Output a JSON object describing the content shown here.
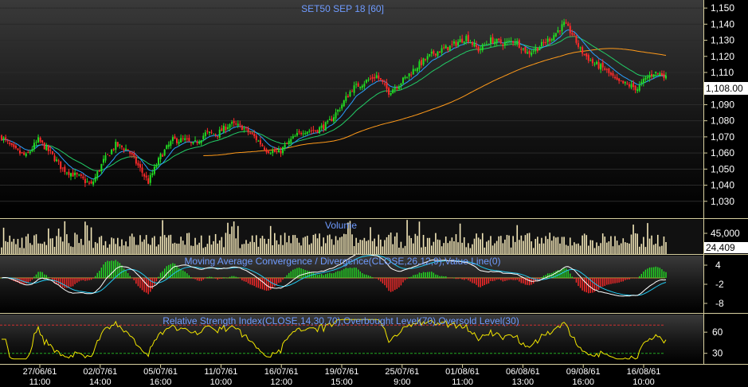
{
  "colors": {
    "bg_top": "#3a3a3a",
    "bg_bottom": "#000000",
    "up_candle": "#22dd22",
    "down_candle": "#ff2a2a",
    "ma_short": "#2aa0ff",
    "ma_mid": "#22cc66",
    "ma_long": "#ff9a1a",
    "volume": "#f2e6b8",
    "macd_line": "#ffffff",
    "signal_line": "#22c8f0",
    "rsi_line": "#f2e600",
    "ob_level": "#d03030",
    "os_level": "#22aa22",
    "title_text": "#6f9bff",
    "panel_border": "#d8d0a0",
    "last_price_box": "#ffffff"
  },
  "chart_data": [
    {
      "type": "candlestick",
      "title": "SET50 SEP 18   [60]",
      "ylim": [
        1020,
        1155
      ],
      "yticks": [
        "1,150",
        "1,140",
        "1,130",
        "1,120",
        "1,110",
        "1,100",
        "1,090",
        "1,080",
        "1,070",
        "1,060",
        "1,050",
        "1,040",
        "1,030"
      ],
      "last_price_label": "1,108.00",
      "last_price": 1108,
      "path_keypoints": [
        [
          0,
          1070
        ],
        [
          6,
          1062
        ],
        [
          12,
          1058
        ],
        [
          18,
          1068
        ],
        [
          24,
          1060
        ],
        [
          30,
          1050
        ],
        [
          38,
          1045
        ],
        [
          44,
          1040
        ],
        [
          50,
          1055
        ],
        [
          56,
          1065
        ],
        [
          62,
          1062
        ],
        [
          68,
          1050
        ],
        [
          72,
          1042
        ],
        [
          78,
          1058
        ],
        [
          84,
          1068
        ],
        [
          90,
          1068
        ],
        [
          94,
          1065
        ],
        [
          100,
          1072
        ],
        [
          106,
          1072
        ],
        [
          112,
          1078
        ],
        [
          118,
          1076
        ],
        [
          124,
          1070
        ],
        [
          130,
          1062
        ],
        [
          136,
          1060
        ],
        [
          142,
          1068
        ],
        [
          148,
          1074
        ],
        [
          154,
          1074
        ],
        [
          160,
          1078
        ],
        [
          166,
          1088
        ],
        [
          172,
          1100
        ],
        [
          178,
          1104
        ],
        [
          184,
          1108
        ],
        [
          190,
          1098
        ],
        [
          196,
          1104
        ],
        [
          204,
          1114
        ],
        [
          212,
          1122
        ],
        [
          220,
          1126
        ],
        [
          228,
          1132
        ],
        [
          234,
          1124
        ],
        [
          240,
          1130
        ],
        [
          246,
          1128
        ],
        [
          252,
          1130
        ],
        [
          258,
          1122
        ],
        [
          264,
          1126
        ],
        [
          270,
          1132
        ],
        [
          276,
          1140
        ],
        [
          280,
          1134
        ],
        [
          284,
          1124
        ],
        [
          290,
          1116
        ],
        [
          296,
          1112
        ],
        [
          302,
          1104
        ],
        [
          308,
          1102
        ],
        [
          312,
          1100
        ],
        [
          316,
          1106
        ],
        [
          320,
          1110
        ],
        [
          324,
          1109
        ],
        [
          326,
          1108
        ]
      ],
      "moving_averages": [
        {
          "color_key": "ma_short",
          "period": 10
        },
        {
          "color_key": "ma_mid",
          "period": 26
        },
        {
          "color_key": "ma_long",
          "period": 100
        }
      ]
    },
    {
      "type": "bar",
      "title": "Volume",
      "yticks": [
        "45,000"
      ],
      "last_value_label": "24,409",
      "ylim": [
        0,
        70000
      ]
    },
    {
      "type": "line",
      "title": "Moving Average Convergence / Divergence(CLOSE,26,12,9),Value Line(0)",
      "yticks": [
        "4",
        "-2",
        "-8"
      ],
      "ylim": [
        -11,
        7
      ]
    },
    {
      "type": "line",
      "title": "Relative Strength Index(CLOSE,14,30,70),Overbought Level(70),Oversold Level(30)",
      "yticks": [
        "60",
        "30"
      ],
      "ylim": [
        15,
        85
      ],
      "overbought": 70,
      "oversold": 30
    }
  ],
  "x_axis": {
    "labels": [
      {
        "date": "27/06/61",
        "time": "11:00"
      },
      {
        "date": "02/07/61",
        "time": "14:00"
      },
      {
        "date": "05/07/61",
        "time": "16:00"
      },
      {
        "date": "11/07/61",
        "time": "10:00"
      },
      {
        "date": "16/07/61",
        "time": "12:00"
      },
      {
        "date": "19/07/61",
        "time": "15:00"
      },
      {
        "date": "25/07/61",
        "time": "9:00"
      },
      {
        "date": "01/08/61",
        "time": "11:00"
      },
      {
        "date": "06/08/61",
        "time": "13:00"
      },
      {
        "date": "09/08/61",
        "time": "16:00"
      },
      {
        "date": "16/08/61",
        "time": "10:00"
      }
    ]
  }
}
